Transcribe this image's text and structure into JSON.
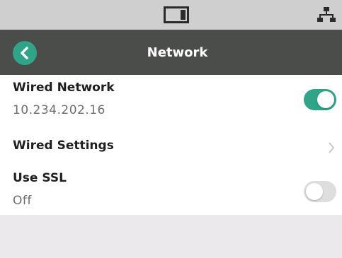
{
  "status_bar": {
    "icons": [
      "screen-icon",
      "network-icon"
    ]
  },
  "header": {
    "title": "Network",
    "back_icon": "back-arrow-icon"
  },
  "settings": {
    "wired_network": {
      "title": "Wired Network",
      "value": "10.234.202.16",
      "enabled": true
    },
    "wired_settings": {
      "title": "Wired Settings",
      "icon": "chevron-right-icon"
    },
    "use_ssl": {
      "title": "Use SSL",
      "value": "Off",
      "enabled": false
    }
  },
  "colors": {
    "accent": "#2fa488",
    "header_bg": "#4b4d4b",
    "status_bg": "#cfcfcf"
  }
}
